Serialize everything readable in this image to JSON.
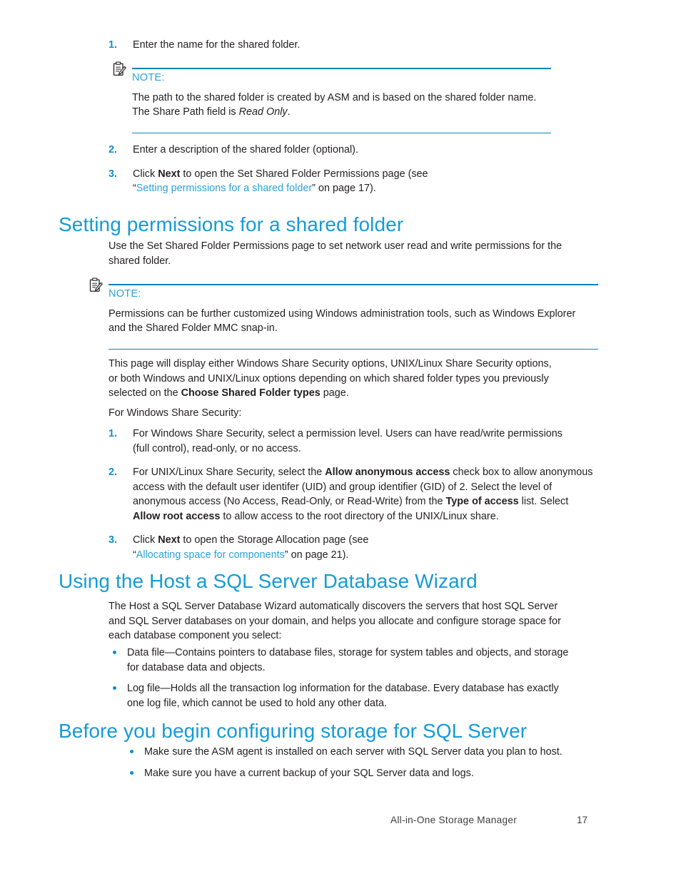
{
  "document": {
    "title": "All-in-One Storage Manager",
    "page_number": "17"
  },
  "steps_top": [
    {
      "num": "1.",
      "text": "Enter the name for the shared folder."
    }
  ],
  "note_one": {
    "icon": "note-clipboard-icon",
    "label": "NOTE:",
    "line1": "The path to the shared folder is created by ASM and is based on the shared folder name.",
    "line2_pre": "The Share Path field is ",
    "line2_italic": "Read Only",
    "line2_post": "."
  },
  "steps_after_note": [
    {
      "num": "2.",
      "text": "Enter a description of the shared folder (optional)."
    }
  ],
  "step_three": {
    "num": "3.",
    "pre": "Click ",
    "bold": "Next",
    "mid": " to open the Set Shared Folder Permissions page (see",
    "quote_open": "“",
    "link": "Setting permissions for a shared folder",
    "quote_close": "”",
    "post": " on page 17)."
  },
  "section_permissions": {
    "heading": "Setting permissions for a shared folder",
    "intro_line1": "Use the Set Shared Folder Permissions page to set network user read and write permissions for the",
    "intro_line2": "shared folder."
  },
  "note_two": {
    "icon": "note-clipboard-icon",
    "label": "NOTE:",
    "line1": "Permissions can be further customized using Windows administration tools, such as Windows Explorer",
    "line2": "and the Shared Folder MMC snap-in."
  },
  "para_share_security": {
    "line1": "This page will display either Windows Share Security options, UNIX/Linux Share Security options,",
    "line2": "or both Windows and UNIX/Linux options depending on which shared folder types you previously",
    "line3_pre": "selected on the ",
    "line3_bold": "Choose Shared Folder types",
    "line3_post": " page."
  },
  "for_windows_label": "For Windows Share Security:",
  "security_steps": [
    {
      "num": "1.",
      "line1": "For Windows Share Security, select a permission level. Users can have read/write permissions",
      "line2": "(full control), read-only, or no access."
    }
  ],
  "security_step_two": {
    "num": "2.",
    "seg1": "For UNIX/Linux Share Security, select the ",
    "bold1": "Allow anonymous access",
    "seg2": " check box to allow anonymous",
    "seg3": "access with the default user identifer (UID) and group identifier (GID) of 2. Select the level of",
    "seg4": "anonymous access (No Access, Read-Only, or Read-Write) from the ",
    "bold2": "Type of access",
    "seg5": " list. Select",
    "bold3": "Allow root access",
    "seg6": " to allow access to the root directory of the UNIX/Linux share."
  },
  "security_step_three": {
    "num": "3.",
    "pre": "Click ",
    "bold": "Next",
    "mid": " to open the Storage Allocation page (see",
    "quote_open": "“",
    "link": "Allocating space for components",
    "quote_close": "”",
    "post": " on page 21)."
  },
  "section_wizard": {
    "heading": "Using the Host a SQL Server Database Wizard",
    "intro_line1": "The Host a SQL Server Database Wizard automatically discovers the servers that host SQL Server",
    "intro_line2": "and SQL Server databases on your domain, and helps you allocate and configure storage space for",
    "intro_line3": "each database component you select:",
    "bullets": [
      {
        "line1": "Data file—Contains pointers to database files, storage for system tables and objects, and storage",
        "line2": "for database data and objects."
      },
      {
        "line1": "Log file—Holds all the transaction log information for the database. Every database has exactly",
        "line2": "one log file, which cannot be used to hold any other data."
      }
    ]
  },
  "section_before_begin": {
    "heading": "Before you begin configuring storage for SQL Server",
    "bullets": [
      {
        "line1": "Make sure the ASM agent is installed on each server with SQL Server data you plan to host."
      },
      {
        "line1": "Make sure you have a current backup of your SQL Server data and logs."
      }
    ]
  },
  "colors": {
    "heading_blue": "#169bd5",
    "link_blue": "#2aa3dd",
    "rule_blue": "#0b82bf",
    "marker_blue": "#0b8fd0",
    "body_black": "#231f20"
  }
}
